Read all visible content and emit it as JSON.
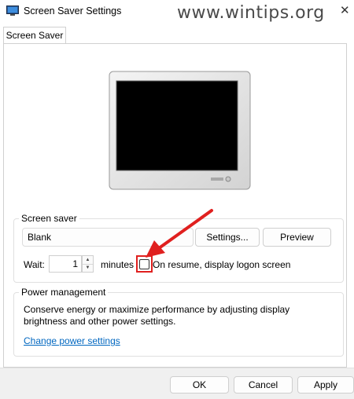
{
  "window": {
    "title": "Screen Saver Settings",
    "watermark": "www.wintips.org",
    "close_icon": "close-icon"
  },
  "tabs": [
    {
      "label": "Screen Saver",
      "active": true
    }
  ],
  "screen_saver": {
    "group_label": "Screen saver",
    "selected": "Blank",
    "settings_label": "Settings...",
    "preview_label": "Preview",
    "wait_label": "Wait:",
    "wait_value": "1",
    "minutes_label": "minutes",
    "resume_label": "On resume, display logon screen",
    "resume_checked": false
  },
  "power": {
    "group_label": "Power management",
    "description": "Conserve energy or maximize performance by adjusting display brightness and other power settings.",
    "link": "Change power settings"
  },
  "footer": {
    "ok_label": "OK",
    "cancel_label": "Cancel",
    "apply_label": "Apply"
  },
  "colors": {
    "highlight_red": "#e0201f",
    "link_blue": "#0067c0"
  }
}
